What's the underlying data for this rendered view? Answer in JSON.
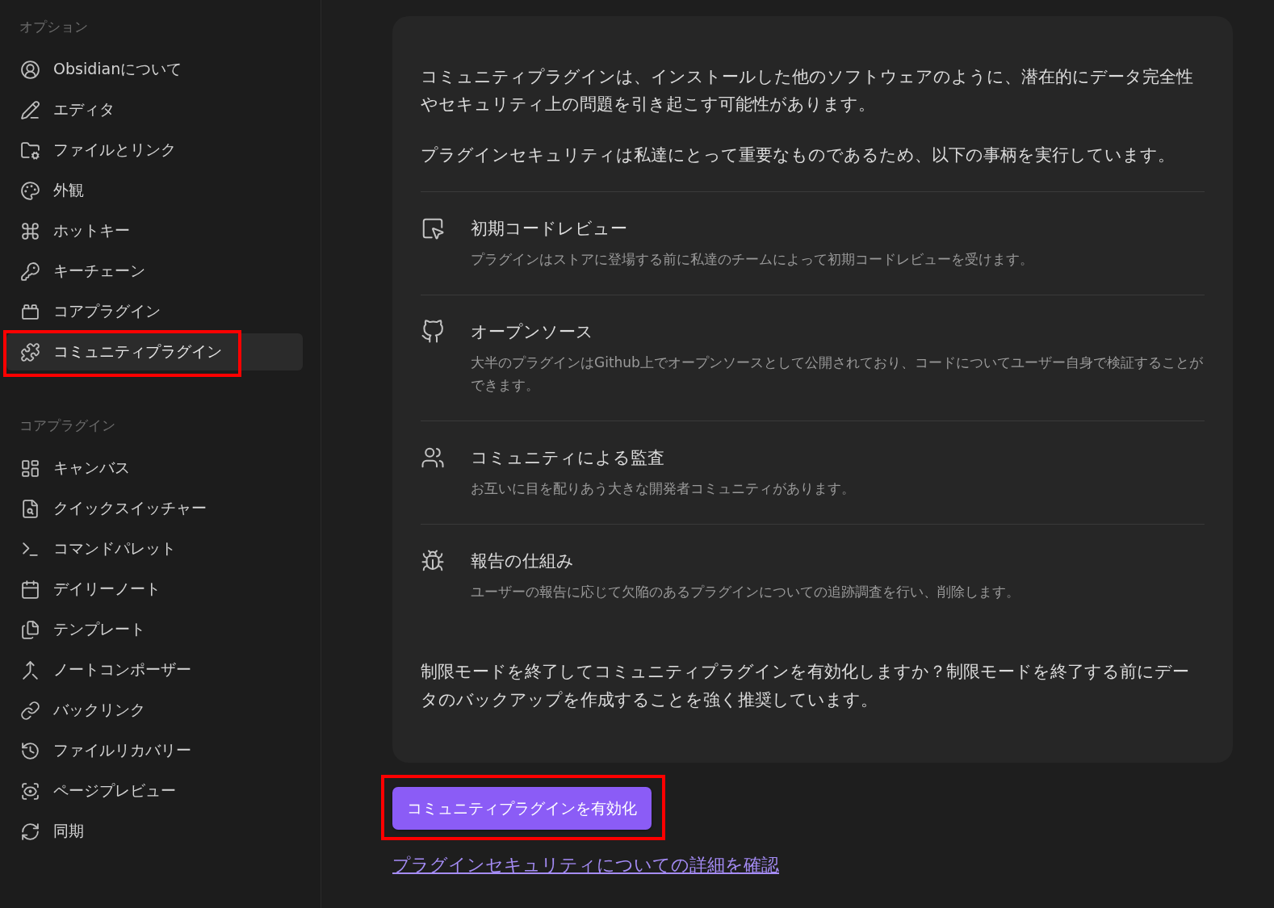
{
  "sidebar": {
    "sections": [
      {
        "heading": "オプション",
        "items": [
          {
            "label": "Obsidianについて",
            "selected": false,
            "highlighted": false
          },
          {
            "label": "エディタ",
            "selected": false,
            "highlighted": false
          },
          {
            "label": "ファイルとリンク",
            "selected": false,
            "highlighted": false
          },
          {
            "label": "外観",
            "selected": false,
            "highlighted": false
          },
          {
            "label": "ホットキー",
            "selected": false,
            "highlighted": false
          },
          {
            "label": "キーチェーン",
            "selected": false,
            "highlighted": false
          },
          {
            "label": "コアプラグイン",
            "selected": false,
            "highlighted": false
          },
          {
            "label": "コミュニティプラグイン",
            "selected": true,
            "highlighted": true
          }
        ]
      },
      {
        "heading": "コアプラグイン",
        "items": [
          {
            "label": "キャンバス",
            "selected": false,
            "highlighted": false
          },
          {
            "label": "クイックスイッチャー",
            "selected": false,
            "highlighted": false
          },
          {
            "label": "コマンドパレット",
            "selected": false,
            "highlighted": false
          },
          {
            "label": "デイリーノート",
            "selected": false,
            "highlighted": false
          },
          {
            "label": "テンプレート",
            "selected": false,
            "highlighted": false
          },
          {
            "label": "ノートコンポーザー",
            "selected": false,
            "highlighted": false
          },
          {
            "label": "バックリンク",
            "selected": false,
            "highlighted": false
          },
          {
            "label": "ファイルリカバリー",
            "selected": false,
            "highlighted": false
          },
          {
            "label": "ページプレビュー",
            "selected": false,
            "highlighted": false
          },
          {
            "label": "同期",
            "selected": false,
            "highlighted": false
          }
        ]
      }
    ]
  },
  "notice": {
    "paragraphs": [
      "コミュニティプラグインは、インストールした他のソフトウェアのように、潜在的にデータ完全性やセキュリティ上の問題を引き起こす可能性があります。",
      "プラグインセキュリティは私達にとって重要なものであるため、以下の事柄を実行しています。"
    ],
    "measures": [
      {
        "title": "初期コードレビュー",
        "description": "プラグインはストアに登場する前に私達のチームによって初期コードレビューを受けます。"
      },
      {
        "title": "オープンソース",
        "description": "大半のプラグインはGithub上でオープンソースとして公開されており、コードについてユーザー自身で検証することができます。"
      },
      {
        "title": "コミュニティによる監査",
        "description": "お互いに目を配りあう大きな開発者コミュニティがあります。"
      },
      {
        "title": "報告の仕組み",
        "description": "ユーザーの報告に応じて欠陥のあるプラグインについての追跡調査を行い、削除します。"
      }
    ],
    "question": "制限モードを終了してコミュニティプラグインを有効化しますか？制限モードを終了する前にデータのバックアップを作成することを強く推奨しています。"
  },
  "enable_button": {
    "label": "コミュニティプラグインを有効化",
    "highlighted": true
  },
  "learn_more_link": "プラグインセキュリティについての詳細を確認"
}
